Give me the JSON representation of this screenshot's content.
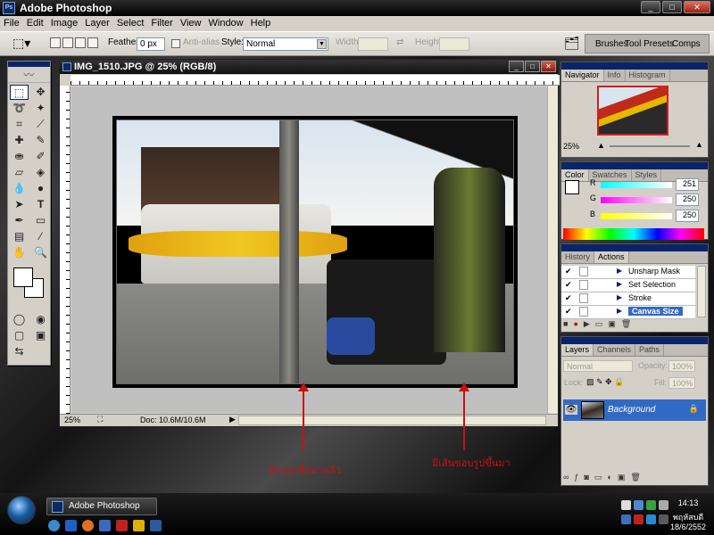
{
  "app": {
    "title": "Adobe Photoshop"
  },
  "menu": [
    "File",
    "Edit",
    "Image",
    "Layer",
    "Select",
    "Filter",
    "View",
    "Window",
    "Help"
  ],
  "options": {
    "feather_label": "Feather:",
    "feather_value": "0 px",
    "antialias_label": "Anti-alias",
    "style_label": "Style:",
    "style_value": "Normal",
    "width_label": "Width:",
    "height_label": "Height:",
    "well_tabs": [
      "Brushes",
      "Tool Presets",
      "Comps"
    ]
  },
  "document": {
    "title": "IMG_1510.JPG @ 25% (RGB/8)",
    "zoom": "25%",
    "doc_info": "Doc: 10.6M/10.6M"
  },
  "navigator": {
    "tabs": [
      "Navigator",
      "Info",
      "Histogram"
    ],
    "zoom": "25%"
  },
  "color": {
    "tabs": [
      "Color",
      "Swatches",
      "Styles"
    ],
    "channels": [
      {
        "label": "R",
        "value": "251",
        "gradient": "linear-gradient(90deg,#00ffff,#ffffff)"
      },
      {
        "label": "G",
        "value": "250",
        "gradient": "linear-gradient(90deg,#ff00ff,#ffffff)"
      },
      {
        "label": "B",
        "value": "250",
        "gradient": "linear-gradient(90deg,#ffff00,#ffffff)"
      }
    ]
  },
  "actions": {
    "tabs": [
      "History",
      "Actions"
    ],
    "items": [
      {
        "label": "Unsharp Mask",
        "selected": false
      },
      {
        "label": "Set Selection",
        "selected": false
      },
      {
        "label": "Stroke",
        "selected": false
      },
      {
        "label": "Canvas Size",
        "selected": true
      }
    ]
  },
  "layers": {
    "tabs": [
      "Layers",
      "Channels",
      "Paths"
    ],
    "blend_mode": "Normal",
    "opacity_label": "Opacity:",
    "opacity_value": "100%",
    "lock_label": "Lock:",
    "fill_label": "Fill:",
    "fill_value": "100%",
    "layer_name": "Background"
  },
  "annotations": {
    "left": "มีกรอบขึ้นมาแล้ว",
    "right": "มีเส้นขอบรูปขึ้นมา"
  },
  "taskbar": {
    "button": "Adobe Photoshop",
    "time": "14:13",
    "day": "พฤหัสบดี",
    "date": "18/6/2552"
  }
}
